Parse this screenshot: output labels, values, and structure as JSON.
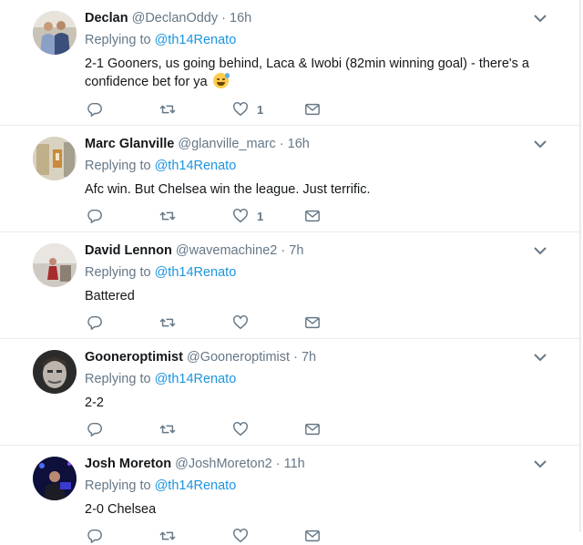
{
  "tweets": [
    {
      "name": "Declan",
      "handle": "@DeclanOddy",
      "dot": "·",
      "time": "16h",
      "replying_prefix": "Replying to",
      "replying_to": "@th14Renato",
      "text": "2-1 Gooners, us going behind, Laca & Iwobi (82min winning goal) - there's a confidence bet for ya",
      "emoji": "grinning-face-with-sweat",
      "likes": "1"
    },
    {
      "name": "Marc Glanville",
      "handle": "@glanville_marc",
      "dot": "·",
      "time": "16h",
      "replying_prefix": "Replying to",
      "replying_to": "@th14Renato",
      "text": "Afc win. But Chelsea win the league. Just terrific.",
      "likes": "1"
    },
    {
      "name": "David Lennon",
      "handle": "@wavemachine2",
      "dot": "·",
      "time": "7h",
      "replying_prefix": "Replying to",
      "replying_to": "@th14Renato",
      "text": "Battered",
      "likes": ""
    },
    {
      "name": "Gooneroptimist",
      "handle": "@Gooneroptimist",
      "dot": "·",
      "time": "7h",
      "replying_prefix": "Replying to",
      "replying_to": "@th14Renato",
      "text": "2-2",
      "likes": ""
    },
    {
      "name": "Josh Moreton",
      "handle": "@JoshMoreton2",
      "dot": "·",
      "time": "11h",
      "replying_prefix": "Replying to",
      "replying_to": "@th14Renato",
      "text": "2-0 Chelsea",
      "likes": ""
    }
  ],
  "icons": {
    "reply": "reply-icon",
    "retweet": "retweet-icon",
    "like": "heart-icon",
    "dm": "envelope-icon",
    "more": "chevron-down-icon"
  },
  "colors": {
    "text": "#14171a",
    "secondary": "#657786",
    "link": "#1b95e0",
    "divider": "#e6ecf0"
  }
}
